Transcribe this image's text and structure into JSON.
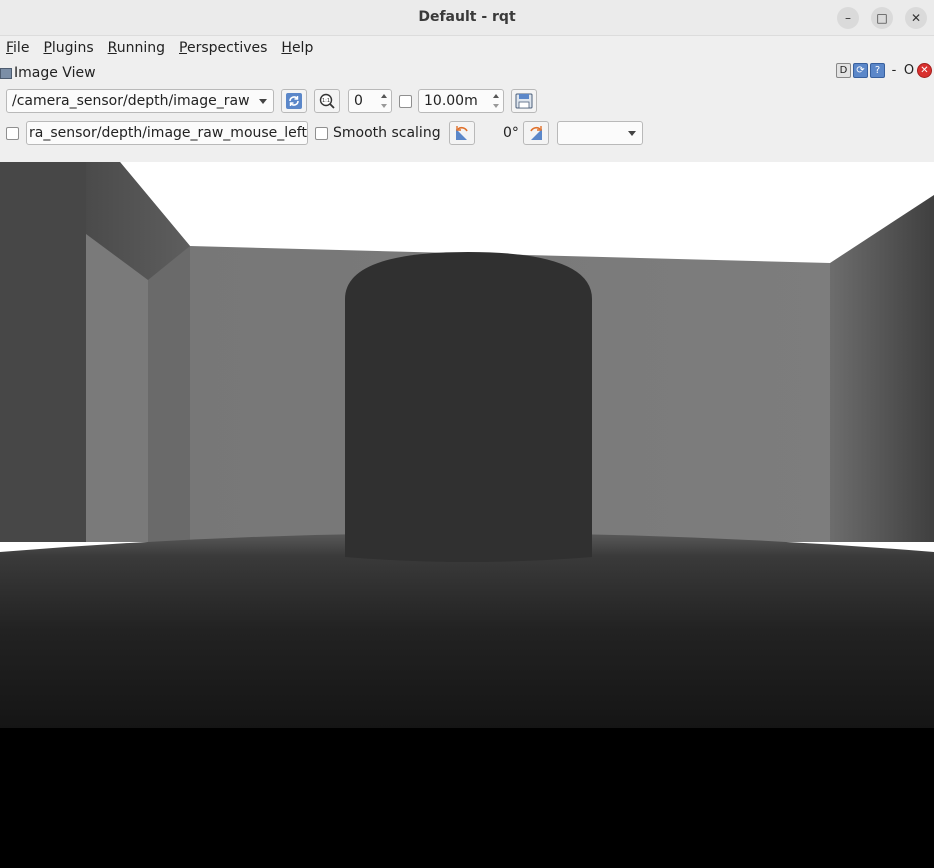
{
  "window": {
    "title": "Default - rqt",
    "controls": {
      "minimize": "–",
      "maximize": "□",
      "close": "✕"
    }
  },
  "menu": [
    "File",
    "Plugins",
    "Running",
    "Perspectives",
    "Help"
  ],
  "plugin": {
    "title": "Image View",
    "right_controls": {
      "d_label": "D",
      "dash": "-",
      "o_label": "O"
    }
  },
  "toolbar": {
    "topic": "/camera_sensor/depth/image_raw",
    "zoom_value": "0",
    "max_range": "10.00m",
    "mouse_topic": "ra_sensor/depth/image_raw_mouse_left",
    "smooth_scaling_label": "Smooth scaling",
    "rotation": "0°",
    "color_scheme": ""
  },
  "icons": {
    "refresh": "refresh-icon",
    "zoom": "zoom-icon",
    "save": "save-icon",
    "rotate_left": "rotate-left-icon",
    "rotate_right": "rotate-right-icon"
  }
}
